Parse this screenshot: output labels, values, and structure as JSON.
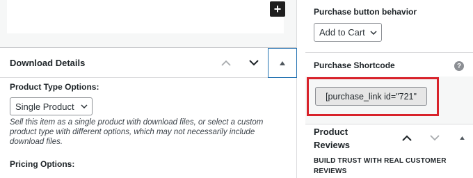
{
  "editor": {
    "add_block_icon": "plus-icon"
  },
  "download_panel": {
    "title": "Download Details",
    "product_type_label": "Product Type Options:",
    "product_type_value": "Single Product",
    "description": "Sell this item as a single product with download files, or select a custom product type with different options, which may not necessarily include download files.",
    "pricing_label": "Pricing Options:"
  },
  "sidebar": {
    "purchase_behavior_label": "Purchase button behavior",
    "purchase_behavior_value": "Add to Cart",
    "shortcode_label": "Purchase Shortcode",
    "help_glyph": "?",
    "shortcode_value": "[purchase_link id=\"721\"",
    "reviews_title": "Product Reviews",
    "reviews_description": "BUILD TRUST WITH REAL CUSTOMER REVIEWS"
  },
  "colors": {
    "highlight": "#d8222a",
    "focus_blue": "#2271b1"
  }
}
